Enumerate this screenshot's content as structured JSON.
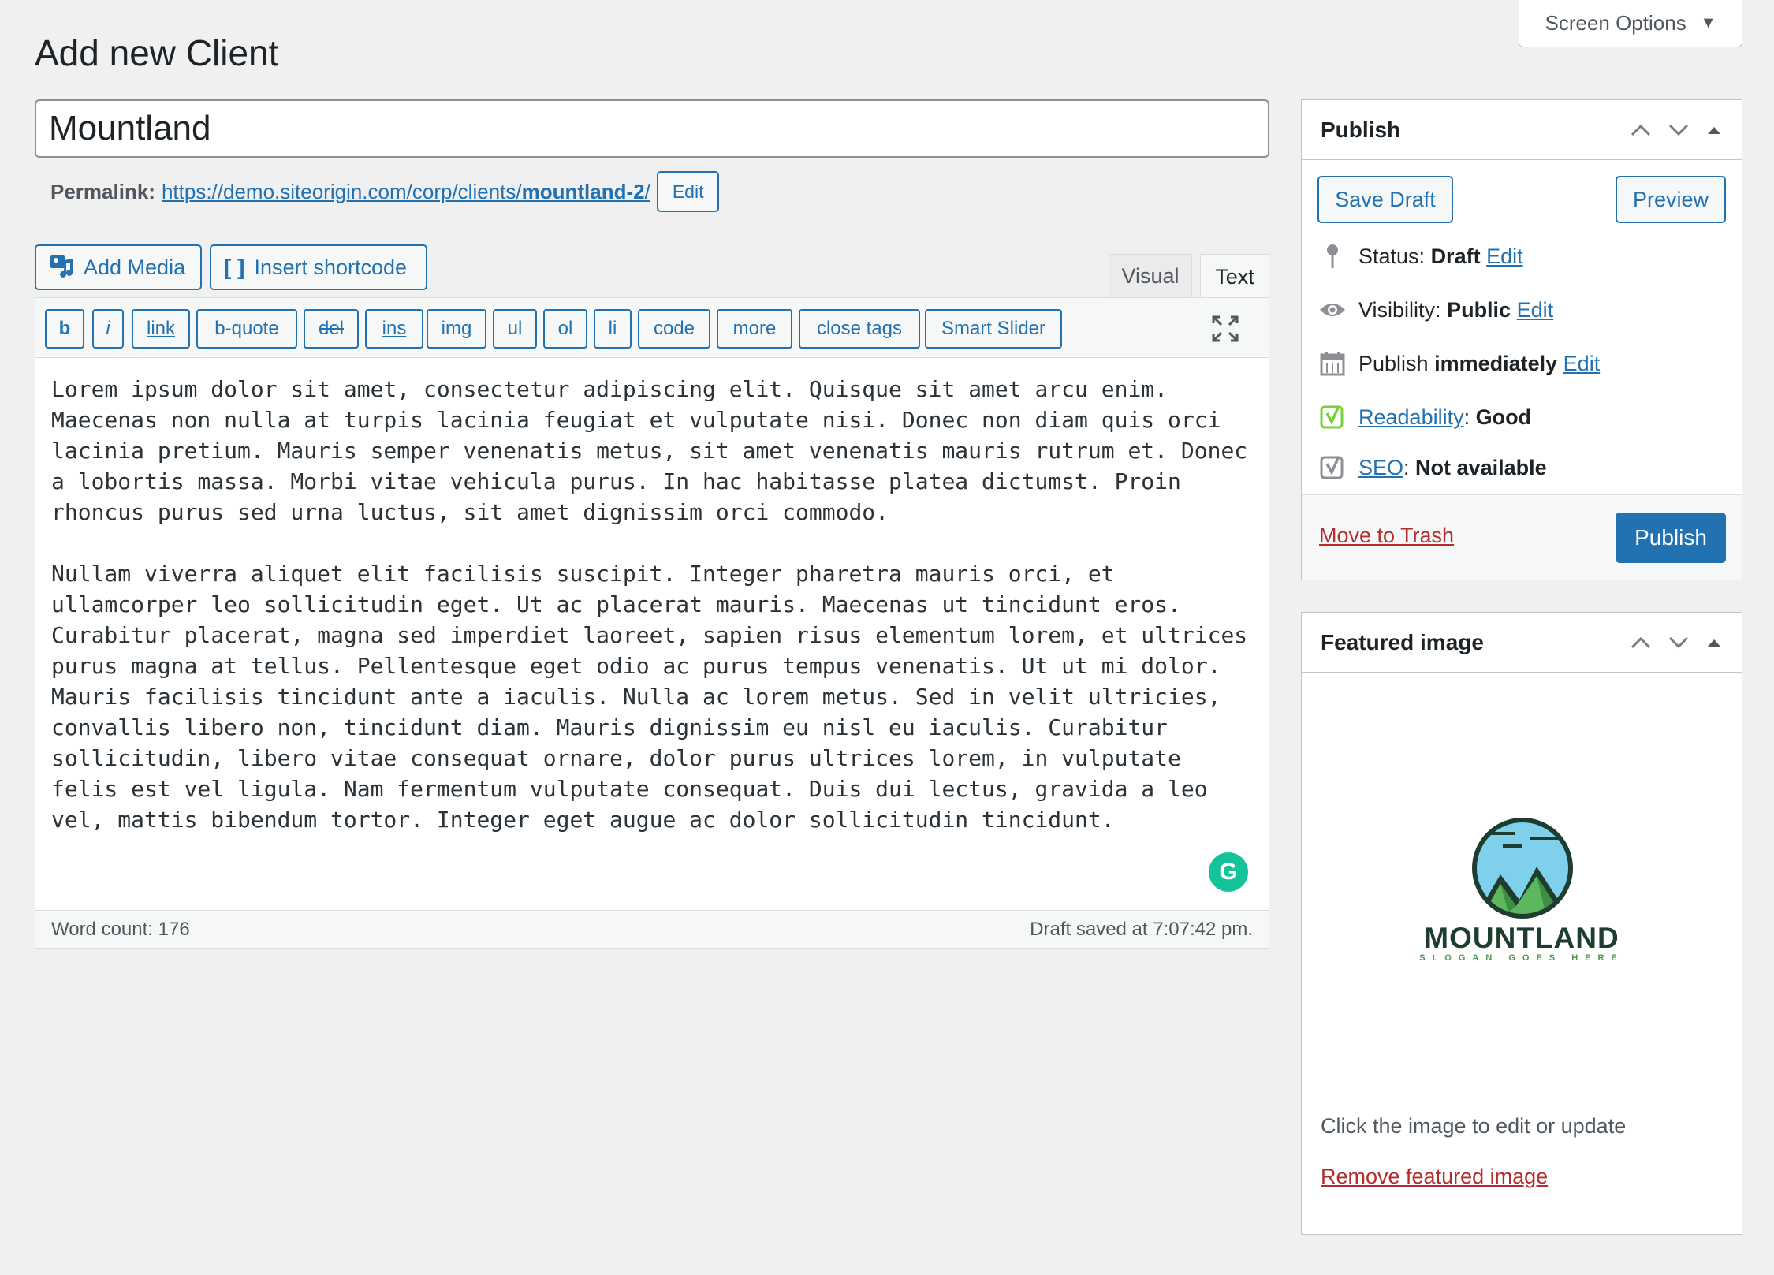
{
  "screen_options": {
    "label": "Screen Options"
  },
  "page_title": "Add new Client",
  "post_title": "Mountland",
  "permalink": {
    "label": "Permalink:",
    "url_base": "https://demo.siteorigin.com/corp/clients/",
    "slug": "mountland-2",
    "url_end": "/",
    "edit_label": "Edit"
  },
  "media_buttons": {
    "add_media": "Add Media",
    "insert_shortcode": "Insert shortcode"
  },
  "editor_tabs": {
    "visual": "Visual",
    "text": "Text"
  },
  "quicktags": [
    "b",
    "i",
    "link",
    "b-quote",
    "del",
    "ins",
    "img",
    "ul",
    "ol",
    "li",
    "code",
    "more",
    "close tags",
    "Smart Slider"
  ],
  "content": {
    "paragraph_1": "Lorem ipsum dolor sit amet, consectetur adipiscing elit. Quisque sit amet arcu enim. Maecenas non nulla at turpis lacinia feugiat et vulputate nisi. Donec non diam quis orci lacinia pretium. Mauris semper venenatis metus, sit amet venenatis mauris rutrum et. Donec a lobortis massa. Morbi vitae vehicula purus. In hac habitasse platea dictumst. Proin rhoncus purus sed urna luctus, sit amet dignissim orci commodo.",
    "paragraph_2": "Nullam viverra aliquet elit facilisis suscipit. Integer pharetra mauris orci, et ullamcorper leo sollicitudin eget. Ut ac placerat mauris. Maecenas ut tincidunt eros. Curabitur placerat, magna sed imperdiet laoreet, sapien risus elementum lorem, et ultrices purus magna at tellus. Pellentesque eget odio ac purus tempus venenatis. Ut ut mi dolor. Mauris facilisis tincidunt ante a iaculis. Nulla ac lorem metus. Sed in velit ultricies, convallis libero non, tincidunt diam. Mauris dignissim eu nisl eu iaculis. Curabitur sollicitudin, libero vitae consequat ornare, dolor purus ultrices lorem, in vulputate felis est vel ligula. Nam fermentum vulputate consequat. Duis dui lectus, gravida a leo vel, mattis bibendum tortor. Integer eget augue ac dolor sollicitudin tincidunt."
  },
  "statusbar": {
    "word_count": "Word count: 176",
    "draft_saved": "Draft saved at 7:07:42 pm."
  },
  "publish_box": {
    "title": "Publish",
    "save_draft": "Save Draft",
    "preview": "Preview",
    "status_label": "Status:",
    "status_value": "Draft",
    "visibility_label": "Visibility:",
    "visibility_value": "Public",
    "publish_label": "Publish",
    "publish_value": "immediately",
    "edit": "Edit",
    "readability_label": "Readability",
    "readability_value": "Good",
    "seo_label": "SEO",
    "seo_value": "Not available",
    "move_to_trash": "Move to Trash",
    "publish_button": "Publish"
  },
  "featured_box": {
    "title": "Featured image",
    "logo_name": "MOUNTLAND",
    "logo_slogan": "SLOGAN GOES HERE",
    "hint": "Click the image to edit or update",
    "remove": "Remove featured image"
  },
  "colors": {
    "accent": "#2271b1",
    "danger": "#b32d2e",
    "background": "#f0f0f1",
    "grammarly": "#15c39a",
    "readability_good": "#7ad03a"
  },
  "icons": [
    "caret-down-icon",
    "media-icon",
    "shortcode-bracket-icon",
    "fullscreen-icon",
    "grammarly-icon",
    "pin-icon",
    "eye-icon",
    "calendar-icon",
    "yoast-icon",
    "chevron-up-icon",
    "chevron-down-icon",
    "triangle-up-icon"
  ]
}
